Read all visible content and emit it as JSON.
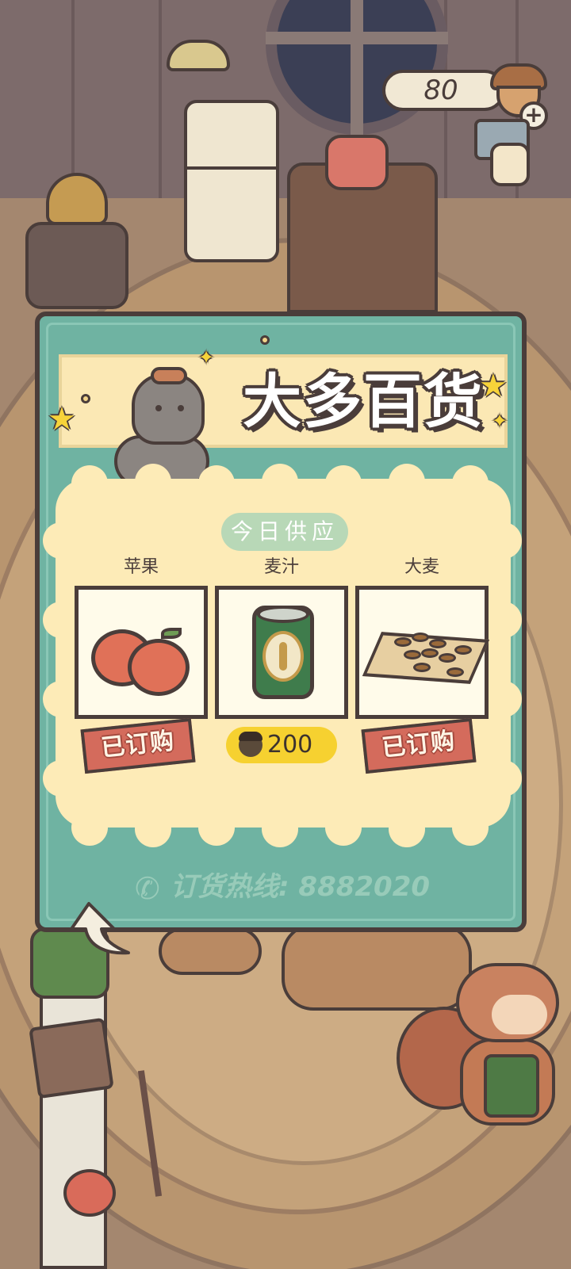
{
  "hud": {
    "acorn_count": "80",
    "add_button": "+"
  },
  "shop": {
    "title": "大多百货",
    "today_supply": "今日供应",
    "hotline": "订货热线: 8882020",
    "items": [
      {
        "name": "苹果",
        "icon": "apple-icon",
        "status": "已订购"
      },
      {
        "name": "麦汁",
        "icon": "malt-can-icon",
        "price": "200"
      },
      {
        "name": "大麦",
        "icon": "barley-icon",
        "status": "已订购"
      }
    ]
  },
  "colors": {
    "panel": "#6fb3a2",
    "supply_bg": "#fdebb7",
    "ordered_tag": "#d46b5c",
    "price_pill": "#f6d130",
    "outline": "#4a3d3a"
  }
}
